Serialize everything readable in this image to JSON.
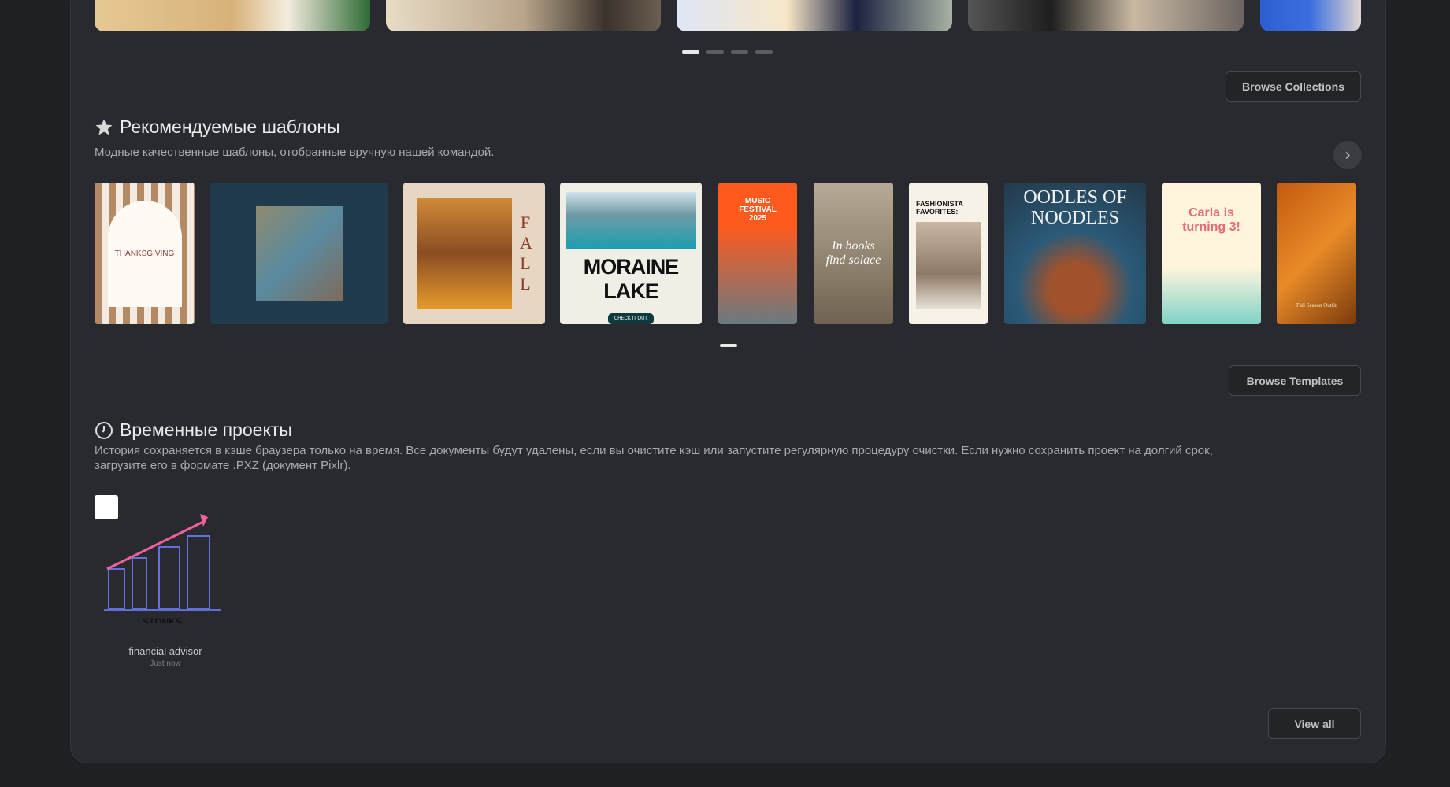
{
  "collections": {
    "browse_label": "Browse Collections",
    "dots": 4,
    "active_dot": 0
  },
  "featured": {
    "title": "Рекомендуемые шаблоны",
    "subtitle": "Модные качественные шаблоны, отобранные вручную нашей командой.",
    "icon": "star-icon",
    "templates": [
      {
        "text": "THANKSGIVING"
      },
      {
        "text": ""
      },
      {
        "text": "FALL"
      },
      {
        "text": "MORAINE LAKE"
      },
      {
        "text": "MUSIC FESTIVAL 2025"
      },
      {
        "text": "In books find solace"
      },
      {
        "text": "FASHIONISTA FAVORITES:"
      },
      {
        "text": "OODLES OF NOODLES"
      },
      {
        "text": "Carla is turning 3!"
      },
      {
        "text": "Fall Season Outfit"
      }
    ],
    "browse_label": "Browse Templates"
  },
  "temporary": {
    "title": "Временные проекты",
    "icon": "clock-icon",
    "description_line1": "История сохраняется в кэше браузера только на время. Все документы будут удалены, если вы очистите кэш или запустите регулярную процедуру очистки. Если нужно сохранить проект на долгий срок,",
    "description_line2": "загрузите его в формате .PXZ (документ Pixlr).",
    "projects": [
      {
        "name": "financial advisor",
        "time": "Just now",
        "thumb_text": "STONKS"
      }
    ],
    "view_all_label": "View all"
  },
  "colors": {
    "panel": "#282a30",
    "background": "#1e2023",
    "arrow": "#f0609a",
    "bars": "#6a78f0"
  }
}
